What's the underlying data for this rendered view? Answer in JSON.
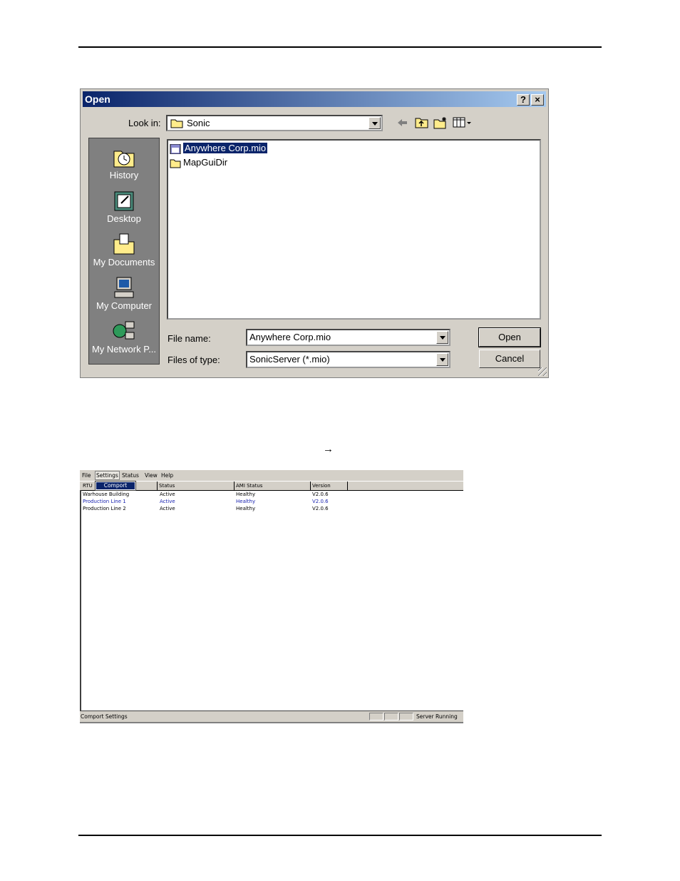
{
  "open_dialog": {
    "title": "Open",
    "help_button": "?",
    "close_button": "×",
    "look_in_label": "Look in:",
    "look_in_value": "Sonic",
    "places": [
      "History",
      "Desktop",
      "My Documents",
      "My Computer",
      "My Network P..."
    ],
    "files": [
      {
        "name": "Anywhere Corp.mio",
        "type": "mio-file-icon",
        "selected": true
      },
      {
        "name": "MapGuiDir",
        "type": "folder-icon",
        "selected": false
      }
    ],
    "file_name_label": "File name:",
    "file_name_value": "Anywhere Corp.mio",
    "files_of_type_label": "Files of type:",
    "files_of_type_value": "SonicServer (*.mio)",
    "open_button": "Open",
    "cancel_button": "Cancel"
  },
  "arrow_glyph": "→",
  "app": {
    "menu": [
      "File",
      "Settings",
      "Status",
      "View",
      "Help"
    ],
    "open_menu_item": "Comport",
    "columns": [
      "RTU",
      "Status",
      "AMI Status",
      "Version"
    ],
    "rows": [
      {
        "rtu": "Warhouse Building",
        "status": "Active",
        "ami": "Healthy",
        "version": "V2.0.6"
      },
      {
        "rtu": "Production Line 1",
        "status": "Active",
        "ami": "Healthy",
        "version": "V2.0.6"
      },
      {
        "rtu": "Production Line 2",
        "status": "Active",
        "ami": "Healthy",
        "version": "V2.0.6"
      }
    ],
    "status_text": "Comport Settings",
    "status_right": "Server Running"
  },
  "colors": {
    "title_bar": "#0a246a",
    "selection": "#0a246a",
    "dialog_face": "#d4d0c8",
    "row_blue": "#1a24b0"
  }
}
